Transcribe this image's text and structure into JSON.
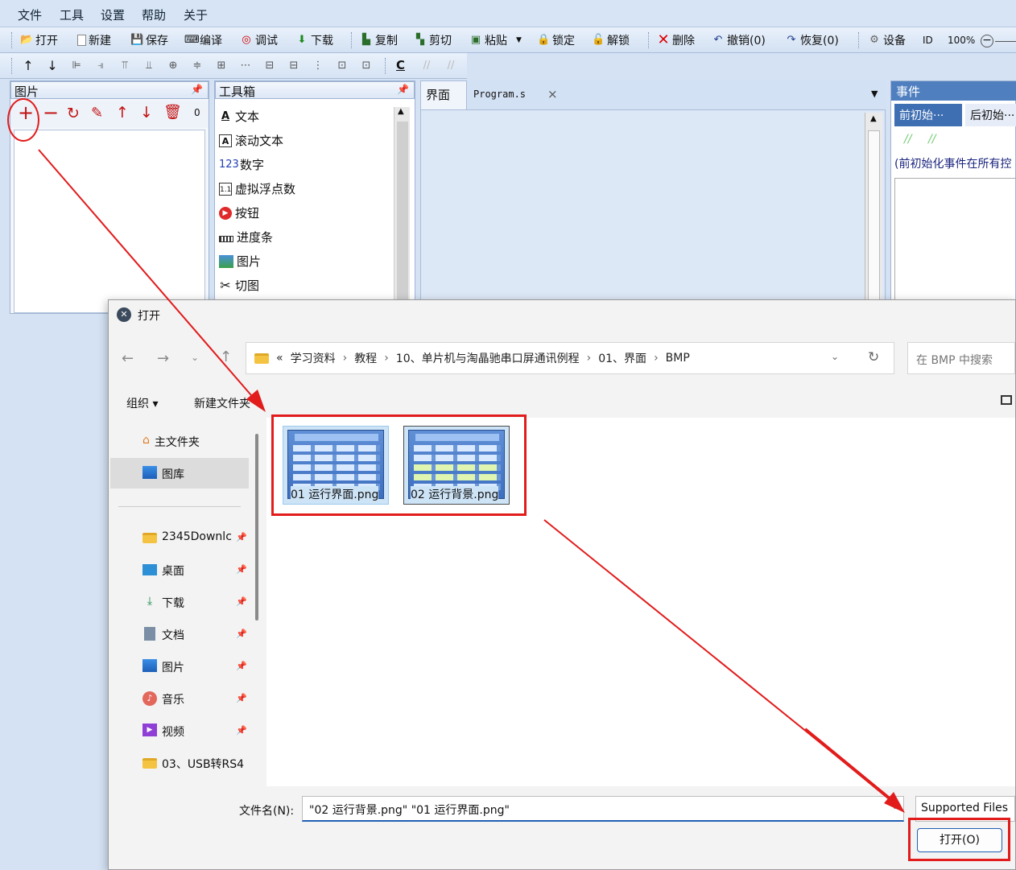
{
  "menu": [
    "文件",
    "工具",
    "设置",
    "帮助",
    "关于"
  ],
  "toolbar1": {
    "open": "打开",
    "new": "新建",
    "save": "保存",
    "compile": "编译",
    "debug": "调试",
    "download": "下载",
    "copy": "复制",
    "cut": "剪切",
    "paste": "粘贴",
    "lock": "锁定",
    "unlock": "解锁",
    "delete": "删除",
    "undo": "撤销(0)",
    "redo": "恢复(0)",
    "settings": "设备",
    "id": "ID",
    "zoom": "100%"
  },
  "toolbar2": {
    "c_label": "C"
  },
  "image_panel": {
    "title": "图片",
    "count": "0"
  },
  "toolbox": {
    "title": "工具箱",
    "items": [
      {
        "label": "文本",
        "icon": "text-icon"
      },
      {
        "label": "滚动文本",
        "icon": "scroll-text-icon"
      },
      {
        "label": "数字",
        "icon": "number-icon"
      },
      {
        "label": "虚拟浮点数",
        "icon": "float-icon"
      },
      {
        "label": "按钮",
        "icon": "button-icon"
      },
      {
        "label": "进度条",
        "icon": "progress-icon"
      },
      {
        "label": "图片",
        "icon": "image-icon"
      },
      {
        "label": "切图",
        "icon": "crop-icon"
      }
    ]
  },
  "tabs": {
    "interface": "界面",
    "program": "Program.s",
    "close": "×"
  },
  "events": {
    "title": "事件",
    "tab1": "前初始···",
    "tab2": "后初始···",
    "desc": "(前初始化事件在所有控"
  },
  "dialog": {
    "title": "打开",
    "breadcrumb": [
      "学习资料",
      "教程",
      "10、单片机与淘晶驰串口屏通讯例程",
      "01、界面",
      "BMP"
    ],
    "breadcrumb_prefix": "«",
    "search_placeholder": "在 BMP 中搜索",
    "organize": "组织 ▾",
    "new_folder": "新建文件夹",
    "sidebar": [
      {
        "label": "主文件夹",
        "icon": "home-icon"
      },
      {
        "label": "图库",
        "icon": "gallery-icon"
      },
      {
        "label": "2345Downlc",
        "icon": "folder-icon"
      },
      {
        "label": "桌面",
        "icon": "desktop-icon"
      },
      {
        "label": "下载",
        "icon": "download-icon"
      },
      {
        "label": "文档",
        "icon": "document-icon"
      },
      {
        "label": "图片",
        "icon": "pictures-icon"
      },
      {
        "label": "音乐",
        "icon": "music-icon"
      },
      {
        "label": "视频",
        "icon": "video-icon"
      },
      {
        "label": "03、USB转RS4",
        "icon": "folder-icon"
      }
    ],
    "files": [
      {
        "name": "01 运行界面.png"
      },
      {
        "name": "02 运行背景.png"
      }
    ],
    "filename_label": "文件名(N):",
    "filename_value": "\"02 运行背景.png\" \"01 运行界面.png\"",
    "filetype": "Supported Files",
    "open_button": "打开(O)"
  },
  "colors": {
    "annotation": "#e21b1b",
    "accent": "#1f5fb3"
  }
}
